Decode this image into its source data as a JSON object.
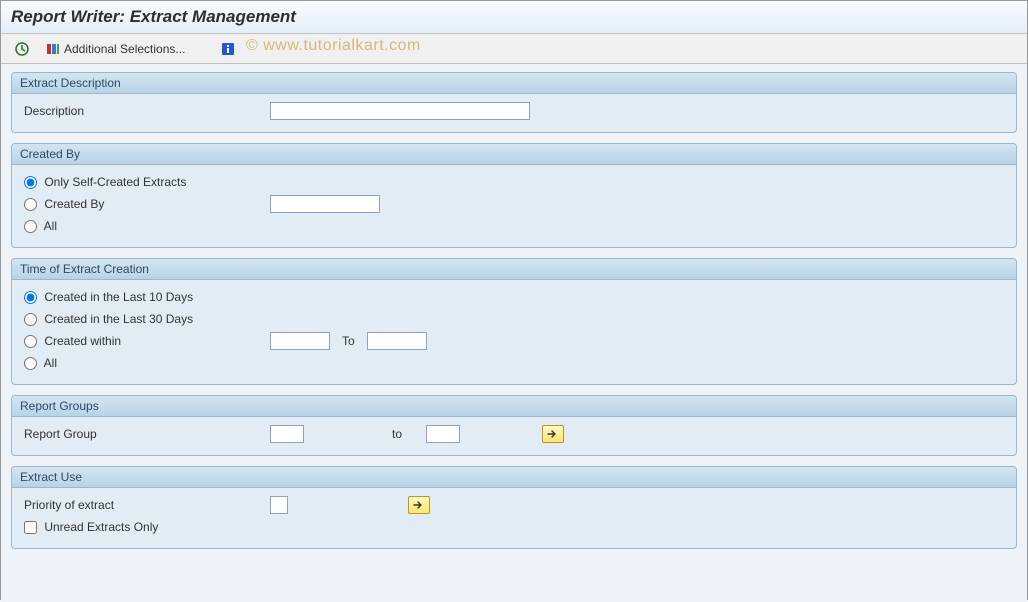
{
  "header": {
    "title": "Report Writer: Extract Management"
  },
  "toolbar": {
    "additional_selections": "Additional Selections..."
  },
  "watermark": "©   www.tutorialkart.com",
  "panels": {
    "extract_description": {
      "title": "Extract Description",
      "field_label": "Description",
      "value": ""
    },
    "created_by": {
      "title": "Created By",
      "opt_self": "Only Self-Created Extracts",
      "opt_createdby": "Created By",
      "opt_all": "All",
      "createdby_value": ""
    },
    "time_creation": {
      "title": "Time of Extract Creation",
      "opt_10": "Created in the Last 10 Days",
      "opt_30": "Created in the Last 30 Days",
      "opt_within": "Created within",
      "to_label": "To",
      "opt_all": "All",
      "from_value": "",
      "to_value": ""
    },
    "report_groups": {
      "title": "Report Groups",
      "label": "Report Group",
      "to_label": "to",
      "from_value": "",
      "to_value": ""
    },
    "extract_use": {
      "title": "Extract Use",
      "priority_label": "Priority of extract",
      "priority_value": "",
      "unread_label": "Unread Extracts Only"
    }
  }
}
